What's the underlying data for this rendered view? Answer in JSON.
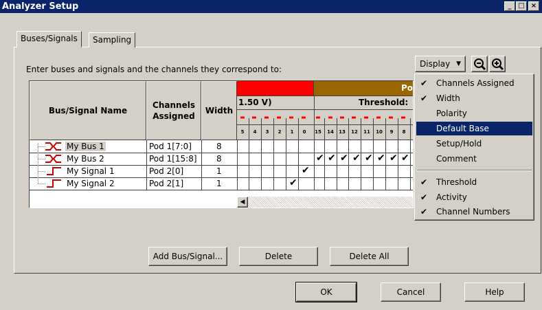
{
  "window": {
    "title": "Analyzer Setup",
    "min": "_",
    "max": "□",
    "close": "×"
  },
  "tabs": [
    {
      "label": "Buses/Signals"
    },
    {
      "label": "Sampling"
    }
  ],
  "instruction": "Enter buses and signals and the channels they correspond to:",
  "grid": {
    "headers": {
      "name": "Bus/Signal Name",
      "channels": "Channels Assigned",
      "width": "Width"
    },
    "pod_header": "Po",
    "threshold_left": "1.50 V)",
    "threshold_right": "Threshold:",
    "channel_numbers_left": [
      "5",
      "4",
      "3",
      "2",
      "1",
      "0"
    ],
    "channel_numbers_right": [
      "15",
      "14",
      "13",
      "12",
      "11",
      "10",
      "9",
      "8"
    ],
    "rows": [
      {
        "name": "My Bus 1",
        "channels": "Pod 1[7:0]",
        "width": "8"
      },
      {
        "name": "My Bus 2",
        "channels": "Pod 1[15:8]",
        "width": "8"
      },
      {
        "name": "My Signal 1",
        "channels": "Pod 2[0]",
        "width": "1"
      },
      {
        "name": "My Signal 2",
        "channels": "Pod 2[1]",
        "width": "1"
      }
    ],
    "checkmark": "✔"
  },
  "display_button": {
    "label": "Display"
  },
  "zoom_out_label": "−",
  "zoom_in_label": "+",
  "display_menu": {
    "items": [
      {
        "label": "Channels Assigned",
        "checked": true
      },
      {
        "label": "Width",
        "checked": true
      },
      {
        "label": "Polarity",
        "checked": false
      },
      {
        "label": "Default Base",
        "checked": false,
        "selected": true
      },
      {
        "label": "Setup/Hold",
        "checked": false
      },
      {
        "label": "Comment",
        "checked": false
      },
      {
        "label": "Threshold",
        "checked": true
      },
      {
        "label": "Activity",
        "checked": true
      },
      {
        "label": "Channel Numbers",
        "checked": true
      }
    ],
    "check_glyph": "✔"
  },
  "buttons": {
    "add": "Add Bus/Signal...",
    "delete": "Delete",
    "delete_all": "Delete All",
    "ok": "OK",
    "cancel": "Cancel",
    "help": "Help"
  },
  "colors": {
    "title_bar": "#0a246a",
    "pod1_header": "#ff0000",
    "pod2_header": "#996600",
    "dash_red": "#ff0000",
    "selection": "#0a246a"
  }
}
